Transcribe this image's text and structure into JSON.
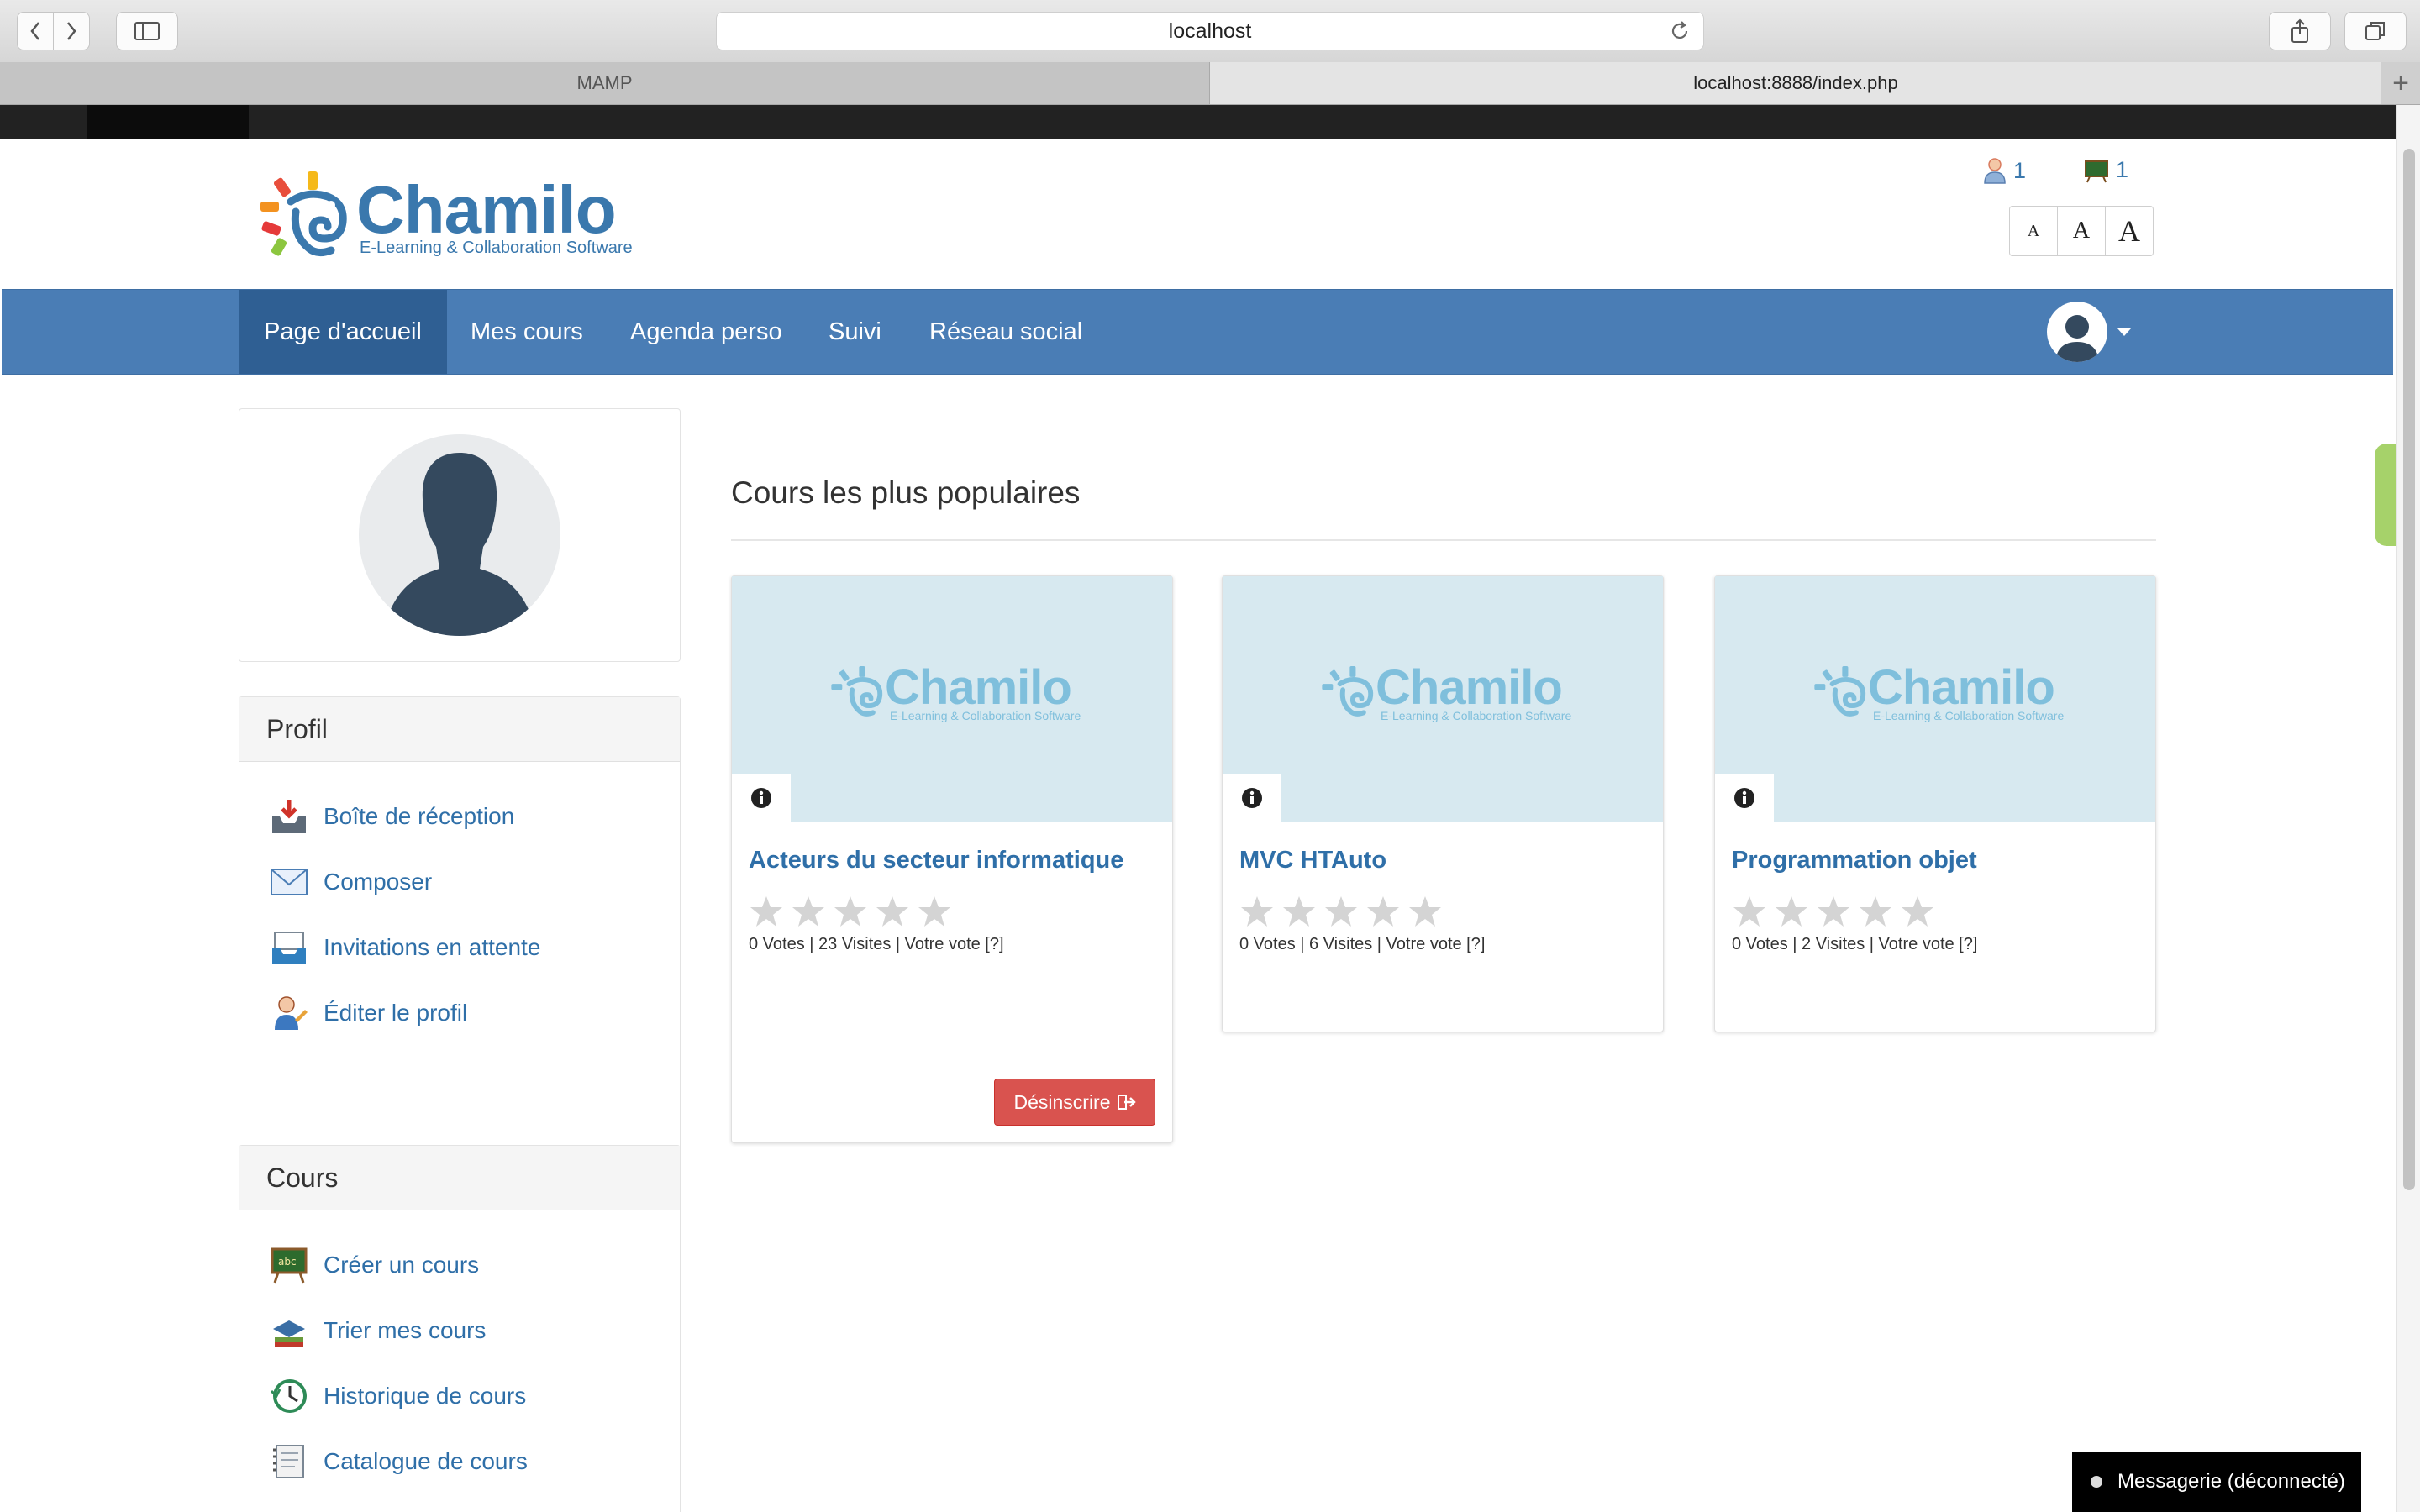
{
  "browser": {
    "url": "localhost",
    "tabs": [
      {
        "label": "MAMP"
      },
      {
        "label": "localhost:8888/index.php"
      }
    ]
  },
  "header": {
    "logo": {
      "name": "Chamilo",
      "tagline": "E-Learning & Collaboration Software"
    },
    "online_users_count": "1",
    "online_courses_count": "1",
    "font_size_buttons": [
      "A",
      "A",
      "A"
    ]
  },
  "navbar": {
    "items": [
      {
        "label": "Page d'accueil",
        "active": true
      },
      {
        "label": "Mes cours"
      },
      {
        "label": "Agenda perso"
      },
      {
        "label": "Suivi"
      },
      {
        "label": "Réseau social"
      }
    ]
  },
  "sidebar": {
    "profile": {
      "title": "Profil",
      "items": [
        {
          "label": "Boîte de réception",
          "icon": "inbox-icon"
        },
        {
          "label": "Composer",
          "icon": "envelope-icon"
        },
        {
          "label": "Invitations en attente",
          "icon": "invitations-icon"
        },
        {
          "label": "Éditer le profil",
          "icon": "edit-profile-icon"
        }
      ]
    },
    "courses": {
      "title": "Cours",
      "items": [
        {
          "label": "Créer un cours",
          "icon": "blackboard-icon"
        },
        {
          "label": "Trier mes cours",
          "icon": "sort-courses-icon"
        },
        {
          "label": "Historique de cours",
          "icon": "history-icon"
        },
        {
          "label": "Catalogue de cours",
          "icon": "catalog-icon"
        }
      ]
    }
  },
  "main": {
    "section_title": "Cours les plus populaires",
    "courses": [
      {
        "title": "Acteurs du secteur informatique",
        "meta": "0 Votes | 23 Visites | Votre vote [?]",
        "rating": 0,
        "button": "Désinscrire"
      },
      {
        "title": "MVC HTAuto",
        "meta": "0 Votes | 6 Visites | Votre vote [?]",
        "rating": 0
      },
      {
        "title": "Programmation objet",
        "meta": "0 Votes | 2 Visites | Votre vote [?]",
        "rating": 0
      }
    ]
  },
  "chat": {
    "label": "Messagerie (déconnecté)"
  },
  "colors": {
    "primary": "#4a7db5",
    "link": "#2f6fa8",
    "danger": "#d9534f",
    "accent_green": "#a6d26a"
  }
}
